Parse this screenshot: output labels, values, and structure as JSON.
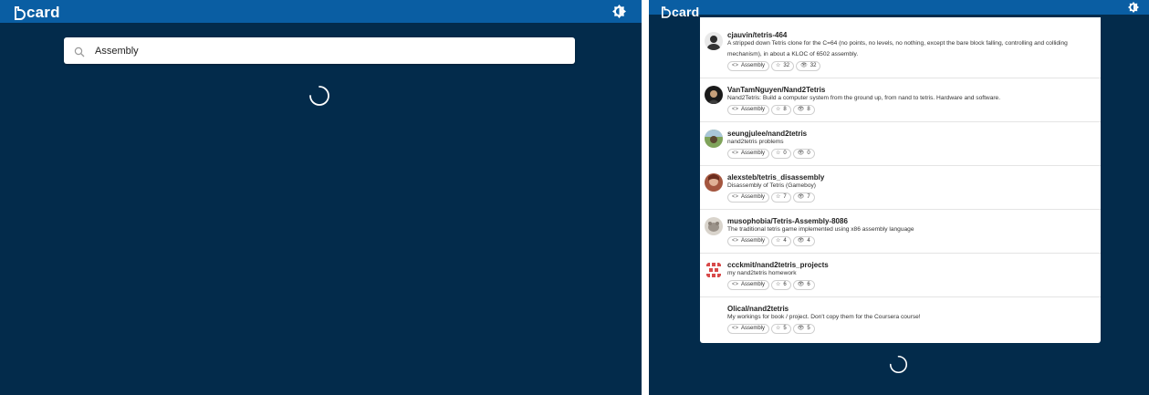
{
  "app": {
    "logo_text": "card",
    "brand_color": "#0a5ea3",
    "bg_color": "#032b4b"
  },
  "left_screen": {
    "search": {
      "value": "Assembly",
      "placeholder": "",
      "icon": "search-icon"
    },
    "theme_icon": "theme-toggle-icon",
    "loading_icon": "spinner-icon"
  },
  "right_screen": {
    "theme_icon": "theme-toggle-icon",
    "loading_icon": "spinner-icon",
    "results": [
      {
        "name": "cjauvin/tetris-464",
        "description": "A stripped down Tetris clone for the C=64 (no points, no levels, no nothing, except the bare block falling, controlling and colliding mechanism), in about a KLOC of 6502 assembly.",
        "language": "Assembly",
        "stars": "32",
        "watchers": "32"
      },
      {
        "name": "VanTamNguyen/Nand2Tetris",
        "description": "Nand2Tetris: Build a computer system from the ground up, from nand to tetris. Hardware and software.",
        "language": "Assembly",
        "stars": "8",
        "watchers": "8"
      },
      {
        "name": "seungjulee/nand2tetris",
        "description": "nand2tetris problems",
        "language": "Assembly",
        "stars": "0",
        "watchers": "0"
      },
      {
        "name": "alexsteb/tetris_disassembly",
        "description": "Disassembly of Tetris (Gameboy)",
        "language": "Assembly",
        "stars": "7",
        "watchers": "7"
      },
      {
        "name": "musophobia/Tetris-Assembly-8086",
        "description": "The traditional tetris game implemented using x86 assembly language",
        "language": "Assembly",
        "stars": "4",
        "watchers": "4"
      },
      {
        "name": "ccckmit/nand2tetris_projects",
        "description": "my nand2tetris homework",
        "language": "Assembly",
        "stars": "6",
        "watchers": "6"
      },
      {
        "name": "Olical/nand2tetris",
        "description": "My workings for book / project. Don't copy them for the Coursera course!",
        "language": "Assembly",
        "stars": "5",
        "watchers": "5"
      }
    ]
  }
}
